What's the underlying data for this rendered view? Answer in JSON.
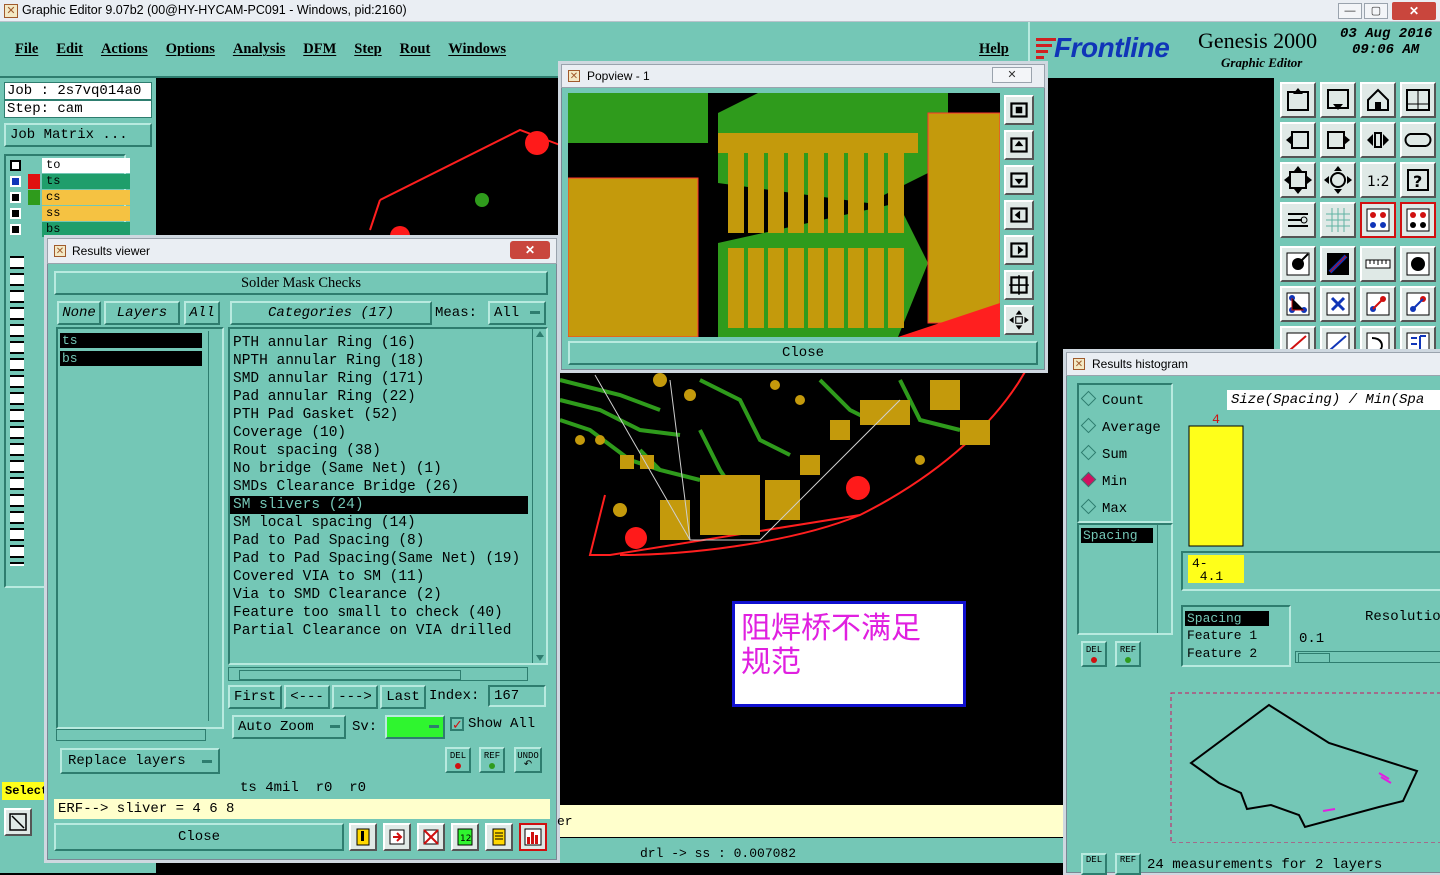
{
  "window": {
    "title": "Graphic Editor 9.07b2 (00@HY-HYCAM-PC091 - Windows, pid:2160)"
  },
  "menu": [
    "File",
    "Edit",
    "Actions",
    "Options",
    "Analysis",
    "DFM",
    "Step",
    "Rout",
    "Windows"
  ],
  "help_label": "Help",
  "brand": {
    "logo": "Frontline",
    "product": "Genesis 2000",
    "subtitle": "Graphic Editor",
    "date": "03 Aug 2016",
    "time": "09:06 AM"
  },
  "job": {
    "job_label": "Job : 2s7vq014a0",
    "step_label": "Step: cam",
    "matrix_button": "Job Matrix ..."
  },
  "layers_panel": [
    {
      "name": "to",
      "color": "#ffffff"
    },
    {
      "name": "ts",
      "color": "#1f9e6b"
    },
    {
      "name": "cs",
      "color": "#f5c242"
    },
    {
      "name": "ss",
      "color": "#f5c242"
    },
    {
      "name": "bs",
      "color": "#1f9e6b"
    }
  ],
  "select_label": "Select",
  "results_viewer": {
    "title": "Results viewer",
    "header": "Solder Mask Checks",
    "none_btn": "None",
    "layers_btn": "Layers",
    "all_btn": "All",
    "categories_label": "Categories (17)",
    "meas_label": "Meas:",
    "meas_value": "All",
    "layers": [
      "ts",
      "bs"
    ],
    "categories": [
      "PTH annular Ring (16)",
      "NPTH annular Ring (18)",
      "SMD annular Ring (171)",
      "Pad annular Ring (22)",
      "PTH Pad Gasket (52)",
      "Coverage (10)",
      "Rout spacing (38)",
      "No bridge (Same Net) (1)",
      "SMDs Clearance Bridge (26)",
      "SM slivers (24)",
      "SM local spacing (14)",
      "Pad to Pad Spacing (8)",
      "Pad to Pad Spacing(Same Net) (19)",
      "Covered VIA to SM (11)",
      "Via to SMD Clearance (2)",
      "Feature too small to check (40)",
      "Partial Clearance on VIA drilled"
    ],
    "selected_category": "SM slivers (24)",
    "nav": {
      "first": "First",
      "prev": "<---",
      "next": "--->",
      "last": "Last",
      "index_label": "Index:",
      "index_value": "167"
    },
    "auto_zoom": "Auto Zoom",
    "sv_label": "Sv:",
    "show_all": "Show All",
    "replace_layers": "Replace layers",
    "small_btns": [
      "DEL",
      "REF",
      "UNDO"
    ],
    "status_line": "ts 4mil  r0  r0",
    "erf_line": "ERF--> sliver = 4 6 8",
    "close": "Close"
  },
  "popview": {
    "title": "Popview - 1",
    "close": "Close"
  },
  "annotation": {
    "line1": "阻焊桥不满足",
    "line2": "规范"
  },
  "status_bar": {
    "text": "drl -> ss : 0.007082",
    "fragment": "er"
  },
  "histogram": {
    "title": "Results histogram",
    "options": [
      "Count",
      "Average",
      "Sum",
      "Min",
      "Max"
    ],
    "selected_option": "Min",
    "list_item": "Spacing",
    "size_label": "Size(Spacing) / Min(Spa",
    "bar_count": "4",
    "bar_value": 4,
    "bar_range": "4-\n 4.1",
    "props": [
      "Spacing",
      "Feature 1",
      "Feature 2"
    ],
    "resolution_label": "Resolutio",
    "resolution_value": "0.1",
    "footer": "24 measurements for 2 layers",
    "small_btns": [
      "DEL",
      "REF"
    ]
  },
  "colors": {
    "teal": "#74c7b6",
    "copper": "#c49a0c",
    "mask_green": "#2f9b1c",
    "outline_red": "#ff1f1f",
    "bar_yellow": "#ffff1a"
  }
}
